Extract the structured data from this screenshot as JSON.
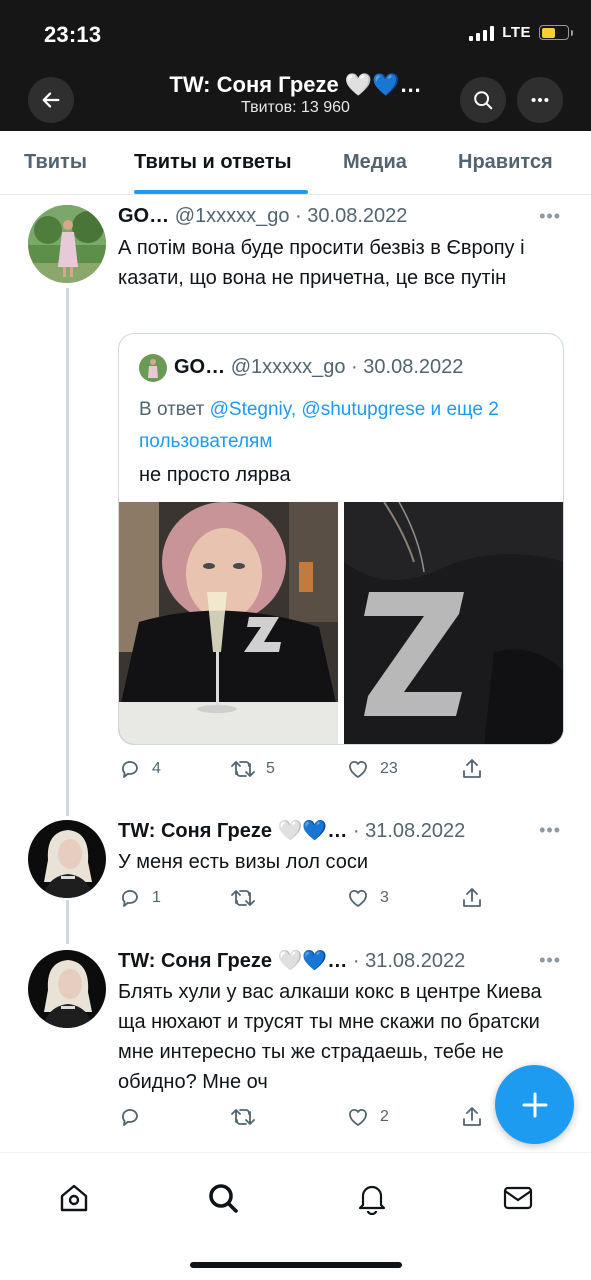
{
  "status_bar": {
    "time": "23:13",
    "network": "LTE",
    "battery_color": "#f5d032"
  },
  "header": {
    "title": "TW: Соня Греze 🤍💙…",
    "subtitle": "Твитов: 13 960"
  },
  "tabs": [
    {
      "label": "Твиты",
      "active": false
    },
    {
      "label": "Твиты и ответы",
      "active": true
    },
    {
      "label": "Медиа",
      "active": false
    },
    {
      "label": "Нравится",
      "active": false
    }
  ],
  "tweets": [
    {
      "name": "GO…",
      "handle": "@1xxxxx_go",
      "date": "· 30.08.2022",
      "text": "А потім вона буде просити безвіз в Європу і казати, що вона не причетна, це все путін",
      "quote": {
        "name": "GO…",
        "handle": "@1xxxxx_go",
        "date": "· 30.08.2022",
        "reply_prefix": "В ответ",
        "reply_links": "@Stegniy, @shutupgrese и еще 2 пользователям",
        "text": "не просто лярва"
      },
      "replies": "4",
      "retweets": "5",
      "likes": "23"
    },
    {
      "name": "TW: Соня Греze 🤍💙…",
      "handle": "",
      "date": "· 31.08.2022",
      "text": "У меня есть визы лол соси",
      "replies": "1",
      "retweets": "",
      "likes": "3"
    },
    {
      "name": "TW: Соня Греze 🤍💙…",
      "handle": "",
      "date": "· 31.08.2022",
      "text": "Блять хули у вас алкаши кокс в центре Киева ща нюхают и трусят ты мне скажи по братски мне интересно ты же страдаешь, тебе не обидно? Мне оч",
      "replies": "",
      "retweets": "",
      "likes": "2"
    }
  ],
  "more_glyph": "•••",
  "colors": {
    "accent": "#1d9bf0",
    "header_bg": "#161616"
  },
  "bottom_nav": [
    "home-icon",
    "search-icon",
    "bell-icon",
    "mail-icon"
  ]
}
